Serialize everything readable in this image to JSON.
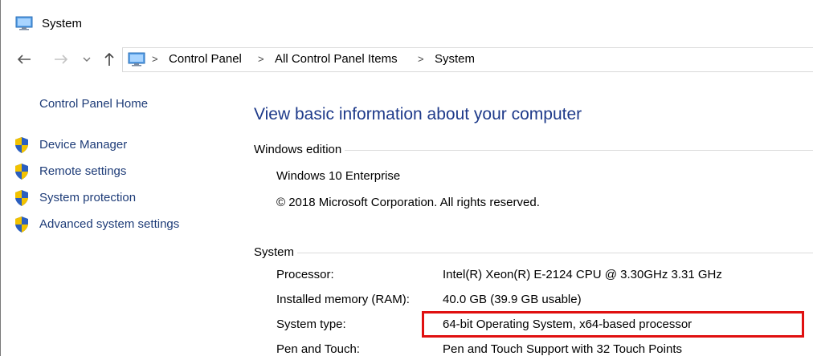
{
  "window": {
    "title": "System",
    "icon": "computer-icon"
  },
  "navigation": {
    "back_icon": "back-arrow-icon",
    "forward_icon": "forward-arrow-icon",
    "recent_icon": "chevron-down-icon",
    "up_icon": "up-arrow-icon",
    "address_icon": "computer-icon",
    "breadcrumbs": [
      "Control Panel",
      "All Control Panel Items",
      "System"
    ],
    "separator": ">"
  },
  "sidebar": {
    "home_label": "Control Panel Home",
    "items": [
      {
        "label": "Device Manager",
        "icon": "shield-icon"
      },
      {
        "label": "Remote settings",
        "icon": "shield-icon"
      },
      {
        "label": "System protection",
        "icon": "shield-icon"
      },
      {
        "label": "Advanced system settings",
        "icon": "shield-icon"
      }
    ]
  },
  "main": {
    "title": "View basic information about your computer",
    "windows_edition": {
      "heading": "Windows edition",
      "edition": "Windows 10 Enterprise",
      "copyright": "© 2018 Microsoft Corporation. All rights reserved."
    },
    "system": {
      "heading": "System",
      "rows": [
        {
          "label": "Processor:",
          "value": "Intel(R) Xeon(R) E-2124 CPU @ 3.30GHz   3.31 GHz"
        },
        {
          "label": "Installed memory (RAM):",
          "value": "40.0 GB (39.9 GB usable)"
        },
        {
          "label": "System type:",
          "value": "64-bit Operating System, x64-based processor"
        },
        {
          "label": "Pen and Touch:",
          "value": "Pen and Touch Support with 32 Touch Points"
        }
      ]
    }
  },
  "colors": {
    "link": "#1e3c78",
    "title": "#1e3a8a",
    "highlight": "#e01010",
    "shield_blue": "#2b5fbf",
    "shield_yellow": "#f2c200"
  }
}
